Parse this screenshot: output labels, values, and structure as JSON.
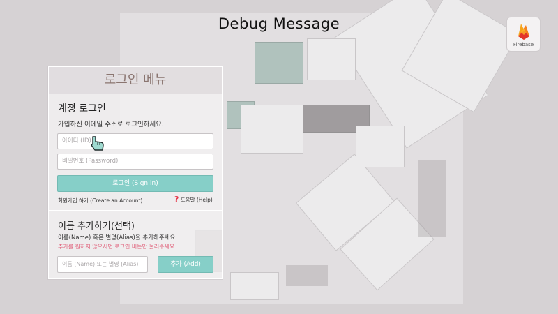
{
  "header": {
    "title": "Debug Message"
  },
  "firebase": {
    "label": "Firebase",
    "icon": "firebase-flame-icon"
  },
  "login_panel": {
    "heading": "로그인 메뉴",
    "account": {
      "title": "계정 로그인",
      "description": "가입하신 이메일 주소로 로그인하세요.",
      "id_placeholder": "아이디 (ID)",
      "password_placeholder": "비밀번호 (Password)",
      "login_label": "로그인 (Sign in)",
      "create_account_label": "회원가입 하기 (Create an Account)",
      "help_label": "도움말 (Help)"
    },
    "alias": {
      "title": "이름 추가하기(선택)",
      "description": "이름(Name) 혹은 별명(Alias)을 추가해주세요.",
      "warning": "추가를 원하지 않으시면 로그인 버튼만 눌러주세요.",
      "alias_placeholder": "이름 (Name) 또는 별명 (Alias)",
      "add_label": "추가 (Add)"
    }
  },
  "colors": {
    "accent": "#86cfc8",
    "warning": "#e0607a",
    "heading": "#8a7570"
  }
}
